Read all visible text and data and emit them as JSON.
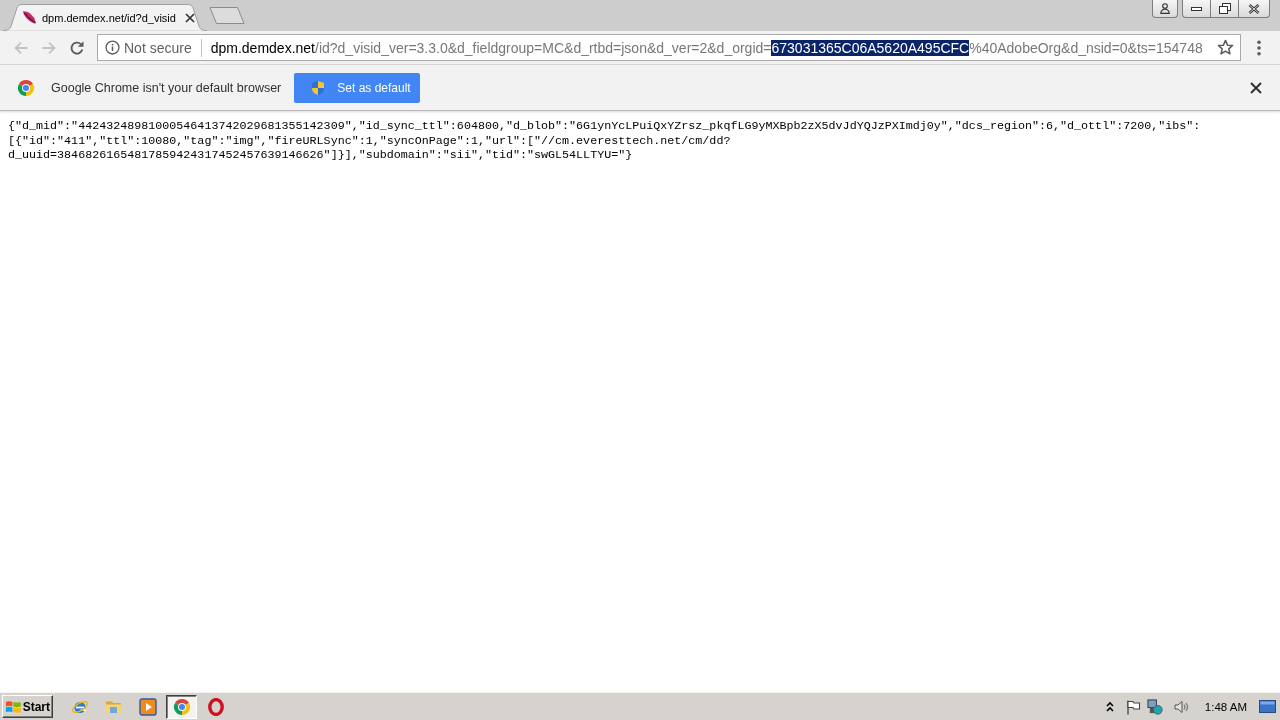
{
  "tabs": [
    {
      "title": "dpm.demdex.net/id?d_visid",
      "selected": true
    }
  ],
  "toolbar": {
    "nav_buttons": [
      {
        "kind": "back",
        "disabled": true
      },
      {
        "kind": "forward",
        "disabled": true
      },
      {
        "kind": "reload",
        "disabled": false
      }
    ],
    "address_bar": {
      "security": "Not secure",
      "url_parts": [
        {
          "kind": "host",
          "text": "dpm.demdex.net"
        },
        {
          "kind": "path",
          "text": "/id?d_visid_ver=3.3.0&d_fieldgroup=MC&d_rtbd=json&d_ver=2&d_orgid="
        },
        {
          "kind": "selection",
          "text": "673031365C06A5620A495CFC"
        },
        {
          "kind": "path",
          "text": "%40AdobeOrg&d_nsid=0&ts=154748"
        }
      ]
    }
  },
  "infobar": {
    "message": "Google Chrome isn't your default browser",
    "button": "Set as default"
  },
  "page": {
    "lines": [
      "{\"d_mid\":\"44243248981000546413742029681355142309\",\"id_sync_ttl\":604800,\"d_blob\":\"6G1ynYcLPuiQxYZrsz_pkqfLG9yMXBpb2zX5dvJdYQJzPXImdj0y\",\"dcs_region\":6,\"d_ottl\":7200,\"ibs\":",
      "[{\"id\":\"411\",\"ttl\":10080,\"tag\":\"img\",\"fireURLSync\":1,\"syncOnPage\":1,\"url\":[\"//cm.everesttech.net/cm/dd?",
      "d_uuid=38468261654817859424317452457639146626\"]}],\"subdomain\":\"sii\",\"tid\":\"swGL54LLTYU=\"}"
    ]
  },
  "taskbar": {
    "start": "Start",
    "apps": [
      {
        "kind": "ie",
        "selected": false
      },
      {
        "kind": "explorer",
        "selected": false
      },
      {
        "kind": "media",
        "selected": false
      },
      {
        "kind": "chrome",
        "selected": true
      },
      {
        "kind": "opera",
        "selected": false
      }
    ],
    "clock": "1:48 AM"
  }
}
